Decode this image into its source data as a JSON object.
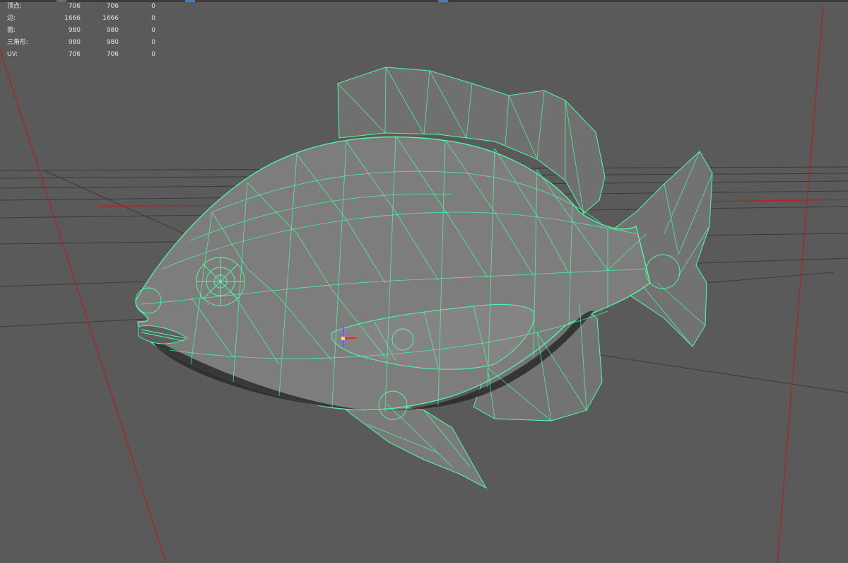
{
  "poly_count_hud": {
    "rows": [
      {
        "label": "顶点:",
        "values": [
          "706",
          "706",
          "0"
        ]
      },
      {
        "label": "边:",
        "values": [
          "1666",
          "1666",
          "0"
        ]
      },
      {
        "label": "面:",
        "values": [
          "980",
          "980",
          "0"
        ]
      },
      {
        "label": "三角形:",
        "values": [
          "980",
          "980",
          "0"
        ]
      },
      {
        "label": "UV:",
        "values": [
          "706",
          "706",
          "0"
        ]
      }
    ]
  },
  "colors": {
    "viewport_background": "#5a5a5a",
    "wireframe": "#4dffa8",
    "mesh_shade": "#7d7d7d",
    "grid_line": "#2f2f2f",
    "axis_x": "#b02020",
    "toolbar": "#3c3c3c",
    "hud_text": "#e4e4e4"
  },
  "icons": {
    "pivot": "pivot-manipulator-icon"
  }
}
